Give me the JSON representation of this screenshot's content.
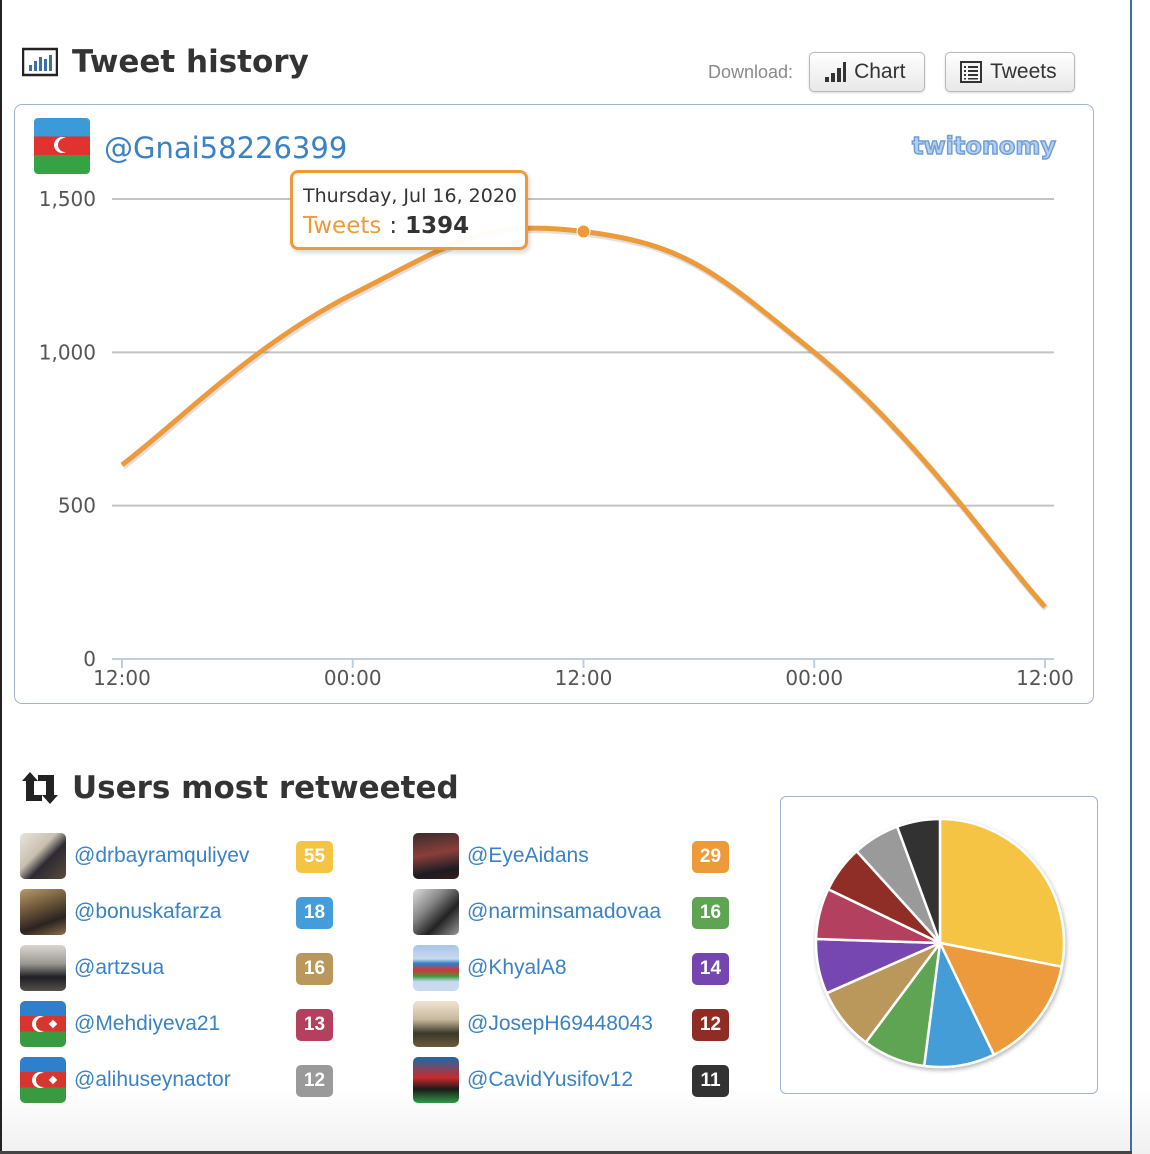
{
  "tweet_history": {
    "title": "Tweet history",
    "download_label": "Download:",
    "chart_button": "Chart",
    "tweets_button": "Tweets",
    "handle": "@Gnai58226399",
    "logo_text": "twitonomy",
    "tooltip": {
      "date": "Thursday, Jul 16, 2020",
      "series": "Tweets",
      "separator": ":",
      "value": "1394"
    }
  },
  "chart_data": [
    {
      "type": "line",
      "title": "Tweet history",
      "xlabel": "",
      "ylabel": "",
      "x_ticks": [
        "12:00",
        "00:00",
        "12:00",
        "00:00",
        "12:00"
      ],
      "y_ticks": [
        "0",
        "500",
        "1,000",
        "1,500"
      ],
      "ylim": [
        0,
        1500
      ],
      "grid": true,
      "series": [
        {
          "name": "Tweets",
          "color": "#ec9a3a",
          "x": [
            0,
            1,
            2,
            3,
            4
          ],
          "values": [
            633,
            1190,
            1394,
            1000,
            170
          ]
        }
      ],
      "highlight": {
        "index": 2,
        "label": "Thursday, Jul 16, 2020",
        "value": 1394
      }
    },
    {
      "type": "pie",
      "title": "Users most retweeted",
      "categories": [
        "@drbayramquliyev",
        "@EyeAidans",
        "@bonuskafarza",
        "@narminsamadovaa",
        "@artzsua",
        "@KhyalA8",
        "@Mehdiyeva21",
        "@JosepH69448043",
        "@alihuseynactor",
        "@CavidYusifov12"
      ],
      "values": [
        55,
        29,
        18,
        16,
        16,
        14,
        13,
        12,
        12,
        11
      ],
      "colors": [
        "#f5c444",
        "#ec9a3a",
        "#449dd8",
        "#5fa452",
        "#ba985c",
        "#7646b0",
        "#b4405e",
        "#8f2d25",
        "#9a9a9a",
        "#333333"
      ]
    }
  ],
  "retweeted": {
    "title": "Users most retweeted",
    "users": [
      {
        "handle": "@drbayramquliyev",
        "count": "55",
        "color": "#f5c444",
        "avatar": "photo"
      },
      {
        "handle": "@bonuskafarza",
        "count": "18",
        "color": "#449dd8",
        "avatar": "photo"
      },
      {
        "handle": "@artzsua",
        "count": "16",
        "color": "#ba985c",
        "avatar": "photo"
      },
      {
        "handle": "@Mehdiyeva21",
        "count": "13",
        "color": "#b4405e",
        "avatar": "flag"
      },
      {
        "handle": "@alihuseynactor",
        "count": "12",
        "color": "#9a9a9a",
        "avatar": "flag"
      },
      {
        "handle": "@EyeAidans",
        "count": "29",
        "color": "#ec9a3a",
        "avatar": "photo"
      },
      {
        "handle": "@narminsamadovaa",
        "count": "16",
        "color": "#5fa452",
        "avatar": "photo"
      },
      {
        "handle": "@KhyalA8",
        "count": "14",
        "color": "#7646b0",
        "avatar": "flag-photo"
      },
      {
        "handle": "@JosepH69448043",
        "count": "12",
        "color": "#8f2d25",
        "avatar": "photo"
      },
      {
        "handle": "@CavidYusifov12",
        "count": "11",
        "color": "#333333",
        "avatar": "photo"
      }
    ]
  }
}
